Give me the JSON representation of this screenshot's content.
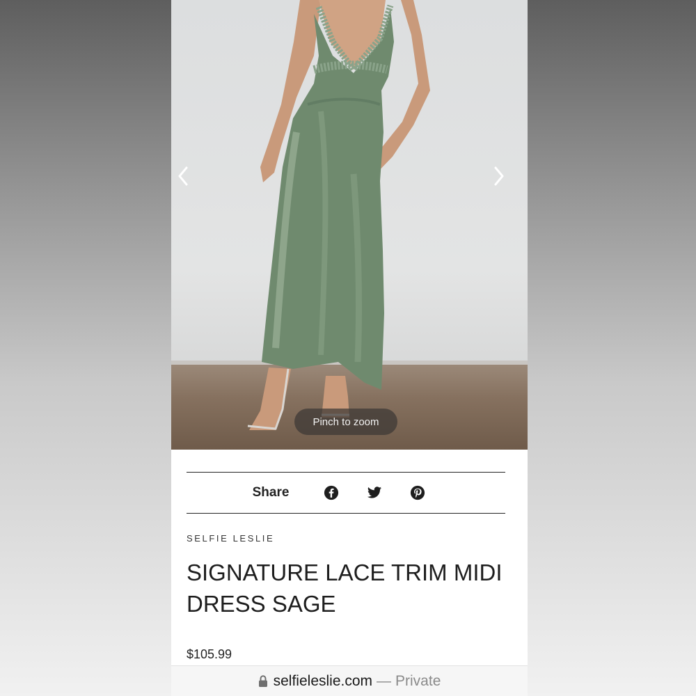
{
  "product_image": {
    "alt": "Model wearing sage satin lace trim midi dress",
    "prev_icon": "chevron-left-icon",
    "next_icon": "chevron-right-icon",
    "pinch_hint": "Pinch to zoom"
  },
  "share": {
    "label": "Share",
    "icons": [
      "facebook-icon",
      "twitter-icon",
      "pinterest-icon"
    ]
  },
  "product": {
    "brand": "SELFIE LESLIE",
    "title": "SIGNATURE LACE TRIM MIDI DRESS SAGE",
    "price": "$105.99"
  },
  "browser": {
    "domain": "selfieleslie.com",
    "separator": "—",
    "mode": "Private",
    "lock_icon": "lock-icon"
  },
  "colors": {
    "dress": "#6f8a6e",
    "pill": "#3c3734",
    "text": "#1e1e1e",
    "private_text": "#8a8a8a"
  }
}
